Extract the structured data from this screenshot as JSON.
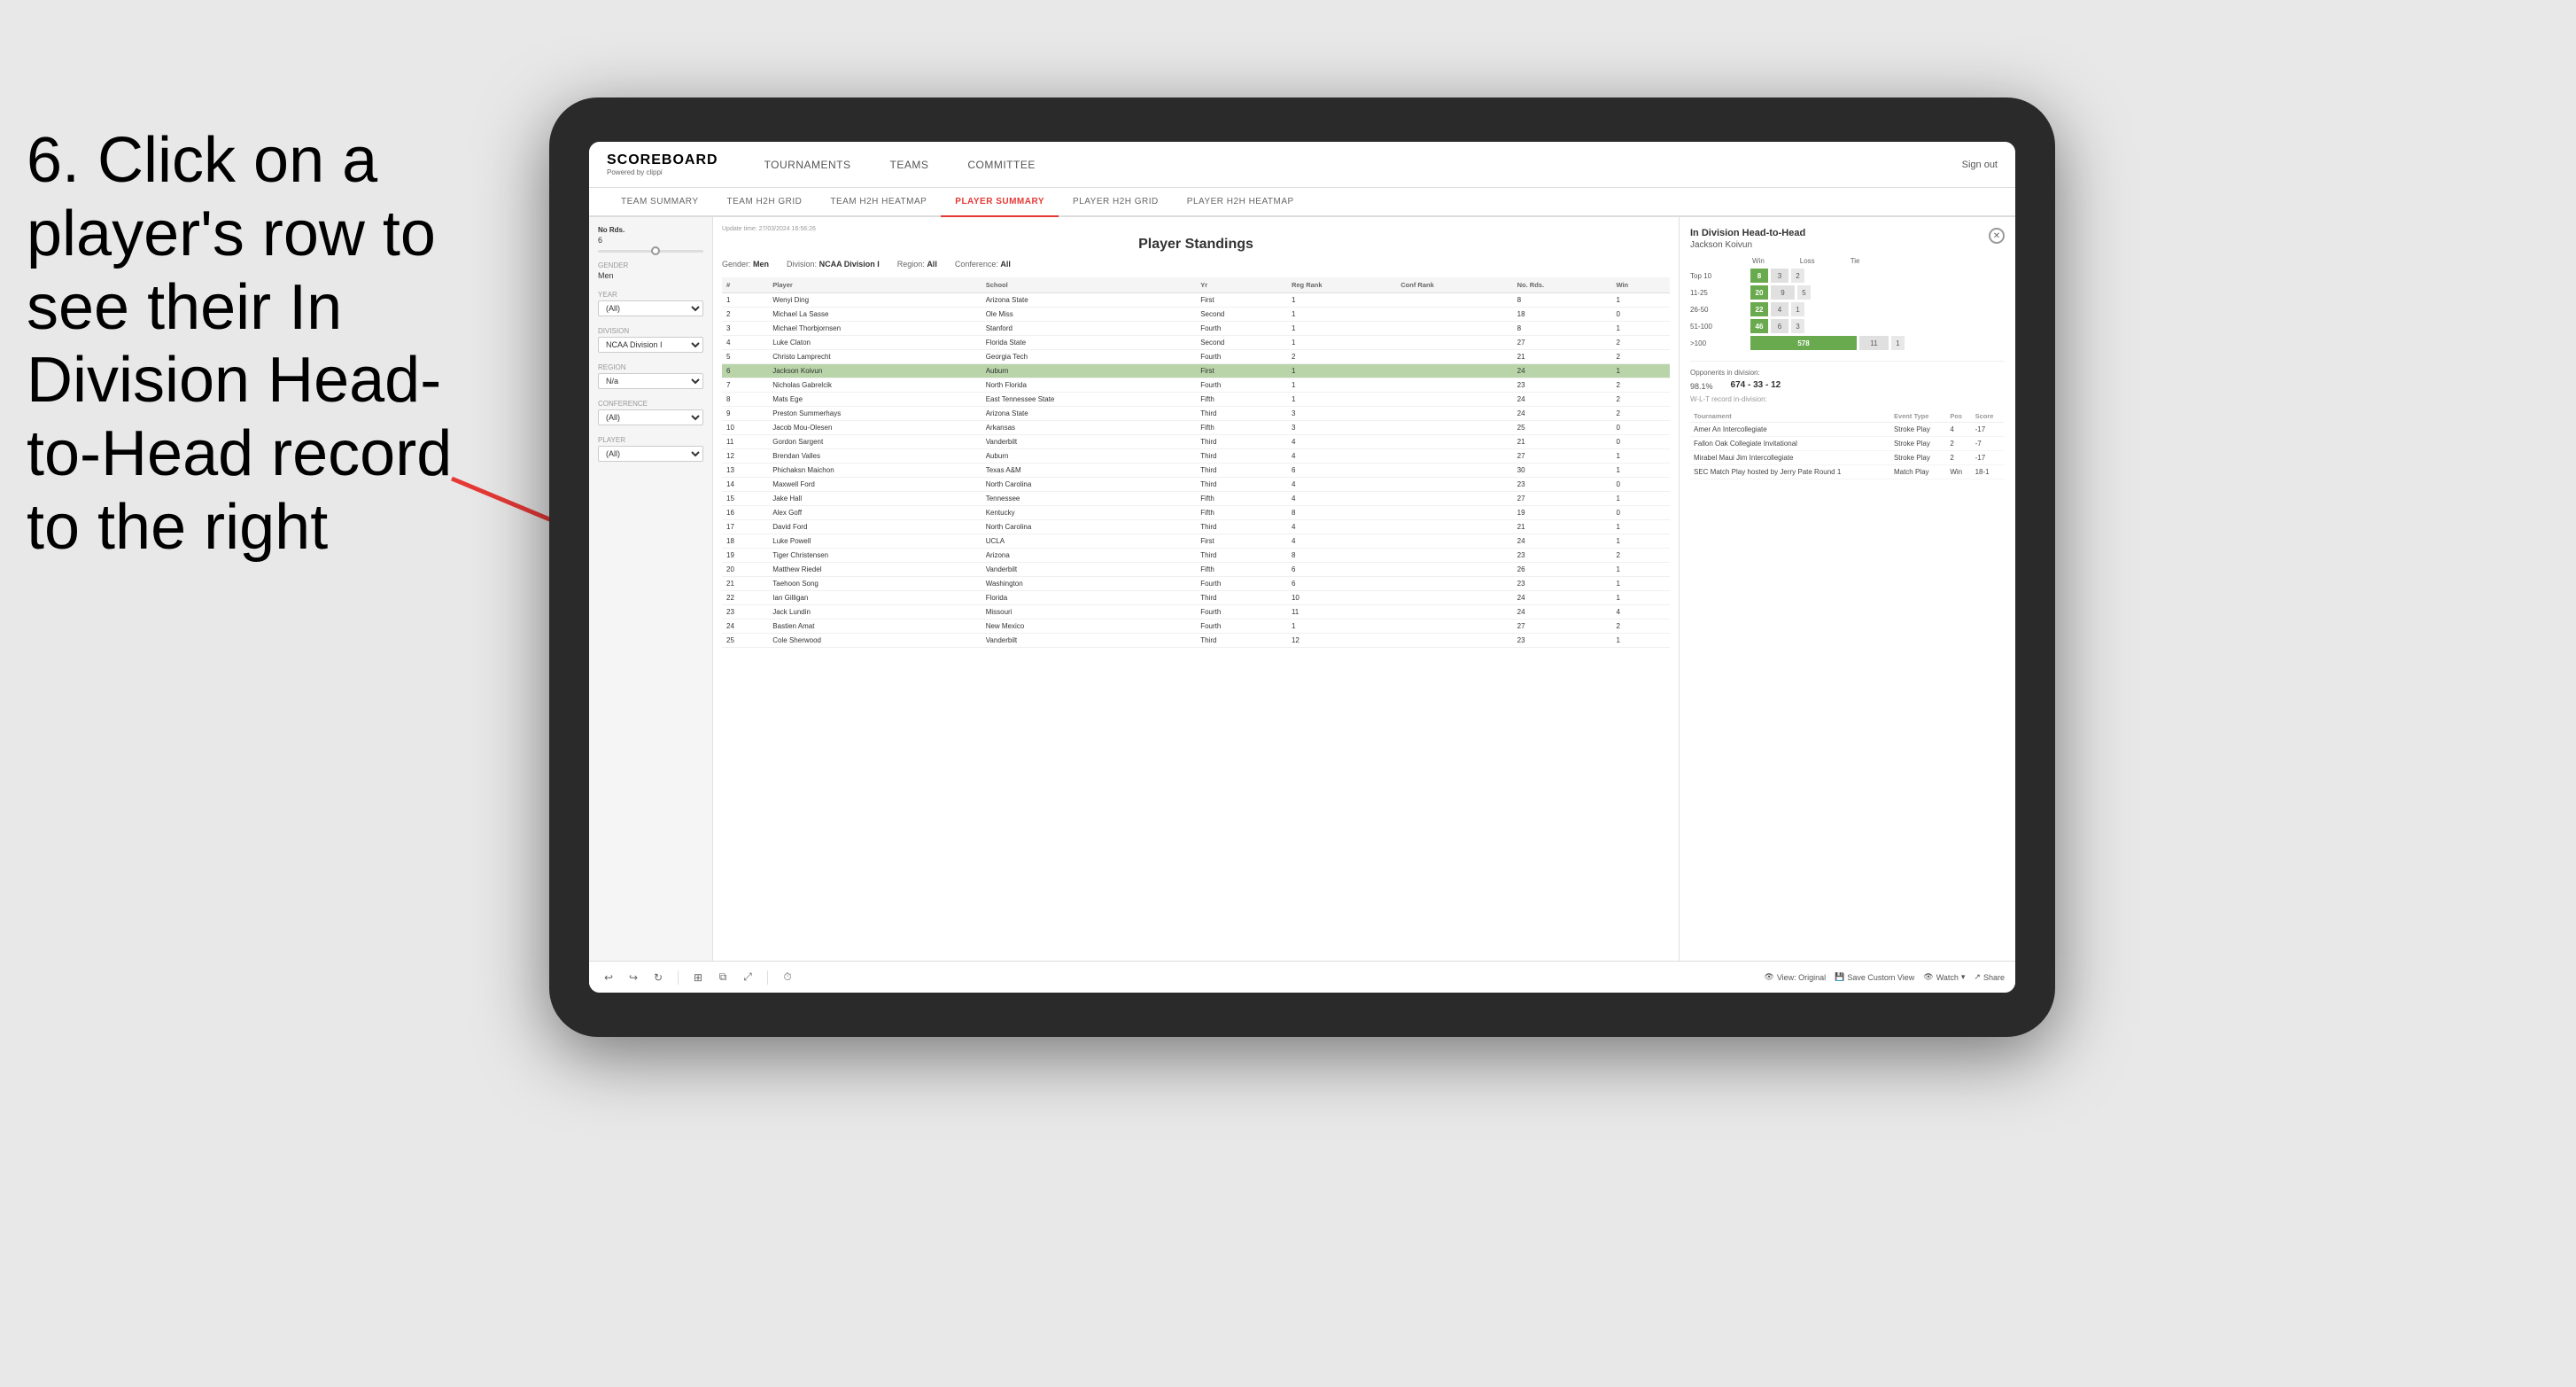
{
  "instruction": {
    "text": "6. Click on a player's row to see their In Division Head-to-Head record to the right"
  },
  "header": {
    "logo_title": "SCOREBOARD",
    "logo_sub": "Powered by clippi",
    "nav_items": [
      "TOURNAMENTS",
      "TEAMS",
      "COMMITTEE"
    ],
    "sign_out": "Sign out"
  },
  "sub_nav": {
    "tabs": [
      "TEAM SUMMARY",
      "TEAM H2H GRID",
      "TEAM H2H HEATMAP",
      "PLAYER SUMMARY",
      "PLAYER H2H GRID",
      "PLAYER H2H HEATMAP"
    ],
    "active": "PLAYER SUMMARY"
  },
  "sidebar": {
    "no_rds_label": "No Rds.",
    "no_rds_value": "6",
    "gender_label": "Gender",
    "gender_value": "Men",
    "year_label": "Year",
    "year_value": "(All)",
    "division_label": "Division",
    "division_value": "NCAA Division I",
    "region_label": "Region",
    "region_value": "N/a",
    "conference_label": "Conference",
    "conference_value": "(All)",
    "player_label": "Player",
    "player_value": "(All)"
  },
  "player_standings": {
    "title": "Player Standings",
    "update_time": "Update time:",
    "update_datetime": "27/03/2024 16:56:26",
    "gender_label": "Gender:",
    "gender_value": "Men",
    "division_label": "Division:",
    "division_value": "NCAA Division I",
    "region_label": "Region:",
    "region_value": "All",
    "conference_label": "Conference:",
    "conference_value": "All",
    "columns": [
      "#",
      "Player",
      "School",
      "Yr",
      "Reg Rank",
      "Conf Rank",
      "No. Rds.",
      "Win"
    ],
    "rows": [
      {
        "rank": 1,
        "player": "Wenyi Ding",
        "school": "Arizona State",
        "year": "First",
        "reg_rank": 1,
        "conf_rank": "",
        "no_rds": 8,
        "win": 1
      },
      {
        "rank": 2,
        "player": "Michael La Sasse",
        "school": "Ole Miss",
        "year": "Second",
        "reg_rank": 1,
        "conf_rank": "",
        "no_rds": 18,
        "win": 0
      },
      {
        "rank": 3,
        "player": "Michael Thorbjornsen",
        "school": "Stanford",
        "year": "Fourth",
        "reg_rank": 1,
        "conf_rank": "",
        "no_rds": 8,
        "win": 1
      },
      {
        "rank": 4,
        "player": "Luke Claton",
        "school": "Florida State",
        "year": "Second",
        "reg_rank": 1,
        "conf_rank": "",
        "no_rds": 27,
        "win": 2
      },
      {
        "rank": 5,
        "player": "Christo Lamprecht",
        "school": "Georgia Tech",
        "year": "Fourth",
        "reg_rank": 2,
        "conf_rank": "",
        "no_rds": 21,
        "win": 2
      },
      {
        "rank": 6,
        "player": "Jackson Koivun",
        "school": "Auburn",
        "year": "First",
        "reg_rank": 1,
        "conf_rank": "",
        "no_rds": 24,
        "win": 1,
        "highlighted": true
      },
      {
        "rank": 7,
        "player": "Nicholas Gabrelcik",
        "school": "North Florida",
        "year": "Fourth",
        "reg_rank": 1,
        "conf_rank": "",
        "no_rds": 23,
        "win": 2
      },
      {
        "rank": 8,
        "player": "Mats Ege",
        "school": "East Tennessee State",
        "year": "Fifth",
        "reg_rank": 1,
        "conf_rank": "",
        "no_rds": 24,
        "win": 2
      },
      {
        "rank": 9,
        "player": "Preston Summerhays",
        "school": "Arizona State",
        "year": "Third",
        "reg_rank": 3,
        "conf_rank": "",
        "no_rds": 24,
        "win": 2
      },
      {
        "rank": 10,
        "player": "Jacob Mou-Olesen",
        "school": "Arkansas",
        "year": "Fifth",
        "reg_rank": 3,
        "conf_rank": "",
        "no_rds": 25,
        "win": 0
      },
      {
        "rank": 11,
        "player": "Gordon Sargent",
        "school": "Vanderbilt",
        "year": "Third",
        "reg_rank": 4,
        "conf_rank": "",
        "no_rds": 21,
        "win": 0
      },
      {
        "rank": 12,
        "player": "Brendan Valles",
        "school": "Auburn",
        "year": "Third",
        "reg_rank": 4,
        "conf_rank": "",
        "no_rds": 27,
        "win": 1
      },
      {
        "rank": 13,
        "player": "Phichaksn Maichon",
        "school": "Texas A&M",
        "year": "Third",
        "reg_rank": 6,
        "conf_rank": "",
        "no_rds": 30,
        "win": 1
      },
      {
        "rank": 14,
        "player": "Maxwell Ford",
        "school": "North Carolina",
        "year": "Third",
        "reg_rank": 4,
        "conf_rank": "",
        "no_rds": 23,
        "win": 0
      },
      {
        "rank": 15,
        "player": "Jake Hall",
        "school": "Tennessee",
        "year": "Fifth",
        "reg_rank": 4,
        "conf_rank": "",
        "no_rds": 27,
        "win": 1
      },
      {
        "rank": 16,
        "player": "Alex Goff",
        "school": "Kentucky",
        "year": "Fifth",
        "reg_rank": 8,
        "conf_rank": "",
        "no_rds": 19,
        "win": 0
      },
      {
        "rank": 17,
        "player": "David Ford",
        "school": "North Carolina",
        "year": "Third",
        "reg_rank": 4,
        "conf_rank": "",
        "no_rds": 21,
        "win": 1
      },
      {
        "rank": 18,
        "player": "Luke Powell",
        "school": "UCLA",
        "year": "First",
        "reg_rank": 4,
        "conf_rank": "",
        "no_rds": 24,
        "win": 1
      },
      {
        "rank": 19,
        "player": "Tiger Christensen",
        "school": "Arizona",
        "year": "Third",
        "reg_rank": 8,
        "conf_rank": "",
        "no_rds": 23,
        "win": 2
      },
      {
        "rank": 20,
        "player": "Matthew Riedel",
        "school": "Vanderbilt",
        "year": "Fifth",
        "reg_rank": 6,
        "conf_rank": "",
        "no_rds": 26,
        "win": 1
      },
      {
        "rank": 21,
        "player": "Taehoon Song",
        "school": "Washington",
        "year": "Fourth",
        "reg_rank": 6,
        "conf_rank": "",
        "no_rds": 23,
        "win": 1
      },
      {
        "rank": 22,
        "player": "Ian Gilligan",
        "school": "Florida",
        "year": "Third",
        "reg_rank": 10,
        "conf_rank": "",
        "no_rds": 24,
        "win": 1
      },
      {
        "rank": 23,
        "player": "Jack Lundin",
        "school": "Missouri",
        "year": "Fourth",
        "reg_rank": 11,
        "conf_rank": "",
        "no_rds": 24,
        "win": 4
      },
      {
        "rank": 24,
        "player": "Bastien Amat",
        "school": "New Mexico",
        "year": "Fourth",
        "reg_rank": 1,
        "conf_rank": "",
        "no_rds": 27,
        "win": 2
      },
      {
        "rank": 25,
        "player": "Cole Sherwood",
        "school": "Vanderbilt",
        "year": "Third",
        "reg_rank": 12,
        "conf_rank": "",
        "no_rds": 23,
        "win": 1
      }
    ]
  },
  "h2h_panel": {
    "title": "In Division Head-to-Head",
    "player_name": "Jackson Koivun",
    "col_headers": [
      "Win",
      "Loss",
      "Tie"
    ],
    "rows": [
      {
        "range": "Top 10",
        "win": 8,
        "loss": 3,
        "tie": 2
      },
      {
        "range": "11-25",
        "win": 20,
        "loss": 9,
        "tie": 5
      },
      {
        "range": "26-50",
        "win": 22,
        "loss": 4,
        "tie": 1
      },
      {
        "range": "51-100",
        "win": 46,
        "loss": 6,
        "tie": 3
      },
      {
        "range": ">100",
        "win": 578,
        "loss": 11,
        "tie": 1
      }
    ],
    "opponents_label": "Opponents in division:",
    "wl_label": "W-L-T record in-division:",
    "percent": "98.1%",
    "record": "674 - 33 - 12",
    "tournament_cols": [
      "Tournament",
      "Event Type",
      "Pos",
      "Score"
    ],
    "tournaments": [
      {
        "name": "Amer An Intercollegiate",
        "type": "Stroke Play",
        "pos": 4,
        "score": "-17"
      },
      {
        "name": "Fallon Oak Collegiate Invitational",
        "type": "Stroke Play",
        "pos": 2,
        "score": "-7"
      },
      {
        "name": "Mirabel Maui Jim Intercollegiate",
        "type": "Stroke Play",
        "pos": 2,
        "score": "-17"
      },
      {
        "name": "SEC Match Play hosted by Jerry Pate Round 1",
        "type": "Match Play",
        "pos": "Win",
        "score": "18-1"
      }
    ]
  },
  "toolbar": {
    "undo": "↩",
    "redo": "↪",
    "refresh": "↻",
    "copy": "⊞",
    "paste": "📋",
    "view_label": "View: Original",
    "save_label": "Save Custom View",
    "watch_label": "Watch",
    "share_label": "Share"
  }
}
